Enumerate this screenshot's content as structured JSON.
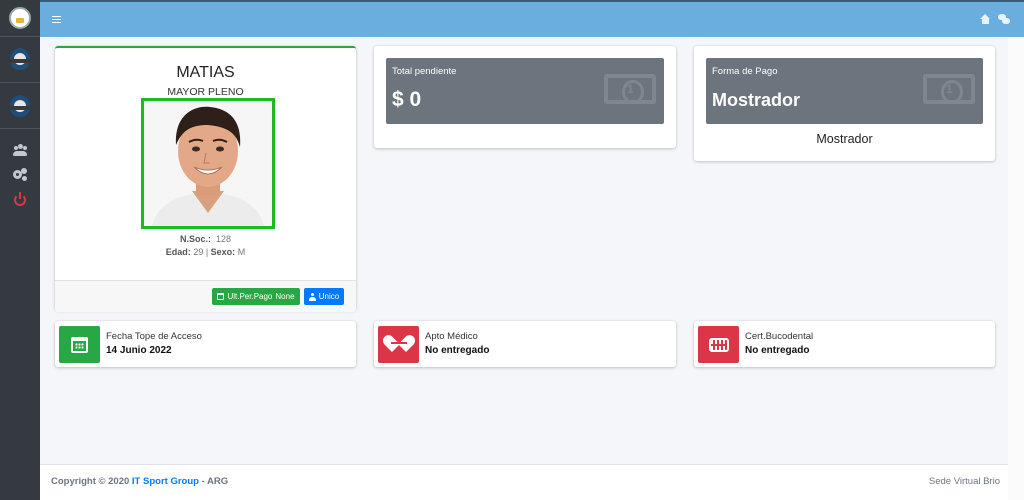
{
  "topbar": {
    "menu_icon": "bars-icon",
    "home_icon": "home-icon",
    "chat_icon": "comments-icon",
    "color": "#6aaee0"
  },
  "sidebar": {
    "items": [
      {
        "icon": "club-logo-icon"
      },
      {
        "icon": "user-avatar-icon"
      },
      {
        "icon": "user-avatar-icon"
      },
      {
        "icon": "users-icon"
      },
      {
        "icon": "cogs-icon"
      },
      {
        "icon": "power-off-icon",
        "color": "#dc3545"
      }
    ]
  },
  "profile": {
    "name": "MATIAS",
    "category": "MAYOR PLENO",
    "nsoc_label": "N.Soc.:",
    "nsoc_value": "128",
    "edad_label": "Edad:",
    "edad_value": "29",
    "sexo_label": "Sexo:",
    "sexo_value": "M",
    "btn_pago_label": "Ult.Per.Pago",
    "btn_pago_value": "None",
    "btn_unico_label": "Unico"
  },
  "total_pendiente": {
    "label": "Total pendiente",
    "value": "$ 0",
    "icon": "money-bill-icon"
  },
  "forma_pago": {
    "label": "Forma de Pago",
    "value": "Mostrador",
    "text": "Mostrador",
    "icon": "money-bill-icon"
  },
  "info_boxes": [
    {
      "label": "Fecha Tope de Acceso",
      "value": "14 Junio 2022",
      "icon": "calendar-icon",
      "color": "#28a745"
    },
    {
      "label": "Apto Médico",
      "value": "No entregado",
      "icon": "heartbeat-icon",
      "color": "#dc3545"
    },
    {
      "label": "Cert.Bucodental",
      "value": "No entregado",
      "icon": "teeth-icon",
      "color": "#dc3545"
    }
  ],
  "footer": {
    "copyright": "Copyright © 2020",
    "company": "IT Sport Group",
    "suffix": "- ARG",
    "right": "Sede Virtual Brio"
  }
}
